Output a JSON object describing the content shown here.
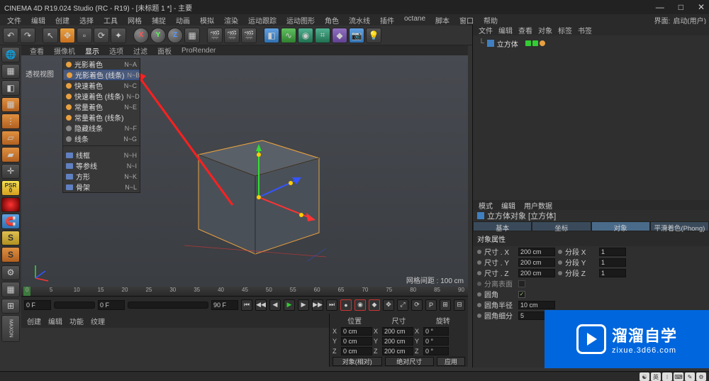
{
  "title": "CINEMA 4D R19.024 Studio (RC - R19) - [未标题 1 *] - 主要",
  "window_controls": {
    "min": "—",
    "max": "□",
    "close": "✕"
  },
  "menubar": [
    "文件",
    "编辑",
    "创建",
    "选择",
    "工具",
    "网格",
    "捕捉",
    "动画",
    "模拟",
    "渲染",
    "运动跟踪",
    "运动图形",
    "角色",
    "流水线",
    "插件",
    "octane",
    "脚本",
    "窗口",
    "帮助"
  ],
  "layout": {
    "label": "界面:",
    "value": "启动(用户)"
  },
  "viewport_tabs": [
    "查看",
    "摄像机",
    "显示",
    "选项",
    "过滤",
    "面板",
    "ProRender"
  ],
  "viewport_label": "透视视图",
  "viewport_info": "网格间距 : 100 cm",
  "context_menu": [
    {
      "group": "shading",
      "items": [
        {
          "label": "光影着色",
          "shortcut": "N~A",
          "dot": "orange"
        },
        {
          "label": "光影着色 (线条)",
          "shortcut": "N~B",
          "dot": "orange",
          "highlight": true
        },
        {
          "label": "快速着色",
          "shortcut": "N~C",
          "dot": "orange"
        },
        {
          "label": "快速着色 (线条)",
          "shortcut": "N~D",
          "dot": "orange"
        },
        {
          "label": "常量着色",
          "shortcut": "N~E",
          "dot": "orange"
        },
        {
          "label": "常量着色 (线条)",
          "shortcut": "",
          "dot": "orange"
        },
        {
          "label": "隐藏线条",
          "shortcut": "N~F",
          "dot": "gray"
        },
        {
          "label": "线条",
          "shortcut": "N~G",
          "dot": "gray"
        }
      ]
    },
    {
      "group": "wire",
      "items": [
        {
          "label": "线框",
          "shortcut": "N~H",
          "icon": "sq"
        },
        {
          "label": "等参线",
          "shortcut": "N~I",
          "icon": "sq"
        },
        {
          "label": "方形",
          "shortcut": "N~K",
          "icon": "sq"
        },
        {
          "label": "骨架",
          "shortcut": "N~L",
          "icon": "sq"
        }
      ]
    }
  ],
  "timeline": {
    "start": "0 F",
    "end": "90 F",
    "current": "0 F",
    "ticks": [
      0,
      5,
      10,
      15,
      20,
      25,
      30,
      35,
      40,
      45,
      50,
      55,
      60,
      65,
      70,
      75,
      80,
      85,
      90
    ]
  },
  "materials_tabs": [
    "创建",
    "编辑",
    "功能",
    "纹理"
  ],
  "coord": {
    "headers": [
      "位置",
      "尺寸",
      "旋转"
    ],
    "rows": [
      {
        "axis": "X",
        "pos": "0 cm",
        "size": "200 cm",
        "rot": "0 °"
      },
      {
        "axis": "Y",
        "pos": "0 cm",
        "size": "200 cm",
        "rot": "0 °"
      },
      {
        "axis": "Z",
        "pos": "0 cm",
        "size": "200 cm",
        "rot": "0 °"
      }
    ],
    "mode1": "对象(相对)",
    "mode2": "绝对尺寸",
    "apply": "应用"
  },
  "obj_mgr": {
    "tabs": [
      "文件",
      "编辑",
      "查看",
      "对象",
      "标签",
      "书签"
    ],
    "item": "立方体"
  },
  "attributes": {
    "tabs": [
      "模式",
      "编辑",
      "用户数据"
    ],
    "object_title": "立方体对象 [立方体]",
    "subtabs": [
      "基本",
      "坐标",
      "对象",
      "平滑着色(Phong)"
    ],
    "active_subtab": 2,
    "section": "对象属性",
    "props": [
      {
        "label": "尺寸 . X",
        "value": "200 cm",
        "label2": "分段 X",
        "value2": "1"
      },
      {
        "label": "尺寸 . Y",
        "value": "200 cm",
        "label2": "分段 Y",
        "value2": "1"
      },
      {
        "label": "尺寸 . Z",
        "value": "200 cm",
        "label2": "分段 Z",
        "value2": "1"
      }
    ],
    "separator": "分离表面",
    "fillet": "圆角",
    "fillet_checked": true,
    "fillet_radius_label": "圆角半径",
    "fillet_radius": "10 cm",
    "fillet_sub_label": "圆角细分",
    "fillet_sub": "5"
  },
  "watermark": {
    "title": "溜溜自学",
    "url": "zixue.3d66.com"
  }
}
